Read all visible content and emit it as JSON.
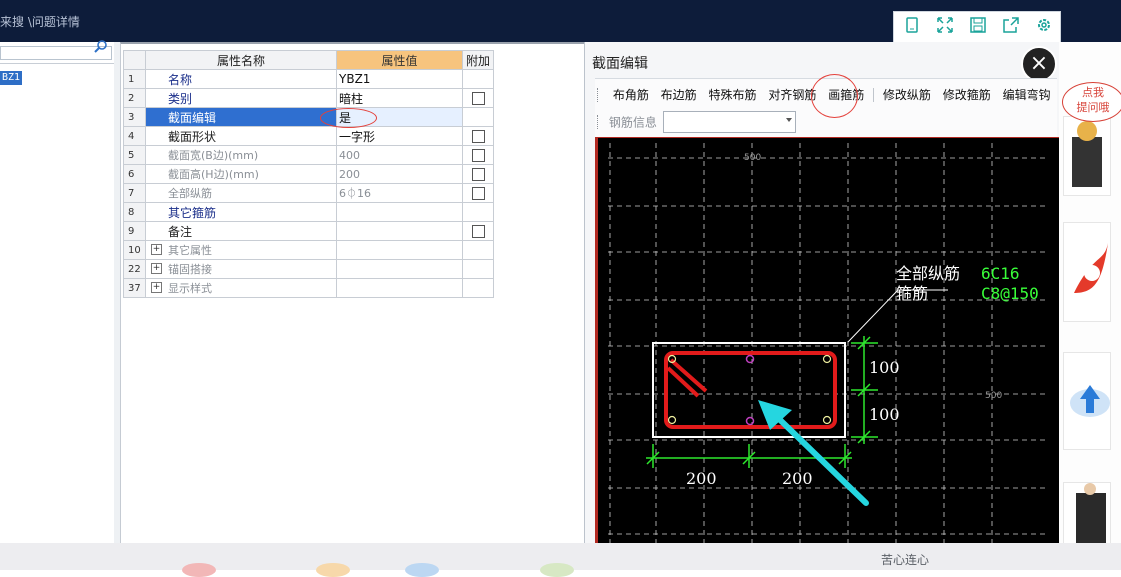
{
  "top_bar": {
    "breadcrumb": "来搜 \\问题详情",
    "toolbar_icons": [
      "tablet-icon",
      "expand-icon",
      "save-icon",
      "share-icon",
      "settings-icon"
    ]
  },
  "left_panel": {
    "search_icon": "search-icon",
    "tree_item": "BZ1"
  },
  "property_grid": {
    "headers": {
      "name": "属性名称",
      "value": "属性值",
      "extra": "附加"
    },
    "rows": [
      {
        "num": "1",
        "name": "名称",
        "value": "YBZ1",
        "checkbox": false,
        "style": "blue"
      },
      {
        "num": "2",
        "name": "类别",
        "value": "暗柱",
        "checkbox": true,
        "style": "blue"
      },
      {
        "num": "3",
        "name": "截面编辑",
        "value": "是",
        "checkbox": false,
        "style": "selected"
      },
      {
        "num": "4",
        "name": "截面形状",
        "value": "一字形",
        "checkbox": true,
        "style": "black"
      },
      {
        "num": "5",
        "name": "截面宽(B边)(mm)",
        "value": "400",
        "checkbox": true,
        "style": "gray"
      },
      {
        "num": "6",
        "name": "截面高(H边)(mm)",
        "value": "200",
        "checkbox": true,
        "style": "gray"
      },
      {
        "num": "7",
        "name": "全部纵筋",
        "value": "6⏀16",
        "checkbox": true,
        "style": "gray"
      },
      {
        "num": "8",
        "name": "其它箍筋",
        "value": "",
        "checkbox": false,
        "style": "blue"
      },
      {
        "num": "9",
        "name": "备注",
        "value": "",
        "checkbox": true,
        "style": "black"
      },
      {
        "num": "10",
        "name": "其它属性",
        "value": "",
        "checkbox": false,
        "style": "group"
      },
      {
        "num": "22",
        "name": "锚固搭接",
        "value": "",
        "checkbox": false,
        "style": "group"
      },
      {
        "num": "37",
        "name": "显示样式",
        "value": "",
        "checkbox": false,
        "style": "group"
      }
    ]
  },
  "dialog": {
    "title": "截面编辑",
    "close_icon": "close-icon",
    "tabs": [
      "布角筋",
      "布边筋",
      "特殊布筋",
      "对齐钢筋",
      "画箍筋",
      "修改纵筋",
      "修改箍筋",
      "编辑弯钩"
    ],
    "rebar_info_label": "钢筋信息",
    "rebar_info_value": ""
  },
  "drawing": {
    "label_long_rebar": "全部纵筋",
    "value_long_rebar": "6C16",
    "label_stirrup": "箍筋",
    "value_stirrup": "C8@150",
    "dim_right_top": "100",
    "dim_right_bottom": "100",
    "dim_bottom_left": "200",
    "dim_bottom_right": "200",
    "grid_label_top": "500",
    "grid_label_right": "500",
    "colors": {
      "rebar": "#e21b1b",
      "outline": "#ffffff",
      "dimension": "#2ee82e",
      "annotation_value": "#39ff39",
      "arrow": "#25d6e0"
    }
  },
  "right_sidebar": {
    "help_bubble": "点我\n提问哦"
  },
  "bottom_bar": {
    "text": "苦心连心"
  }
}
